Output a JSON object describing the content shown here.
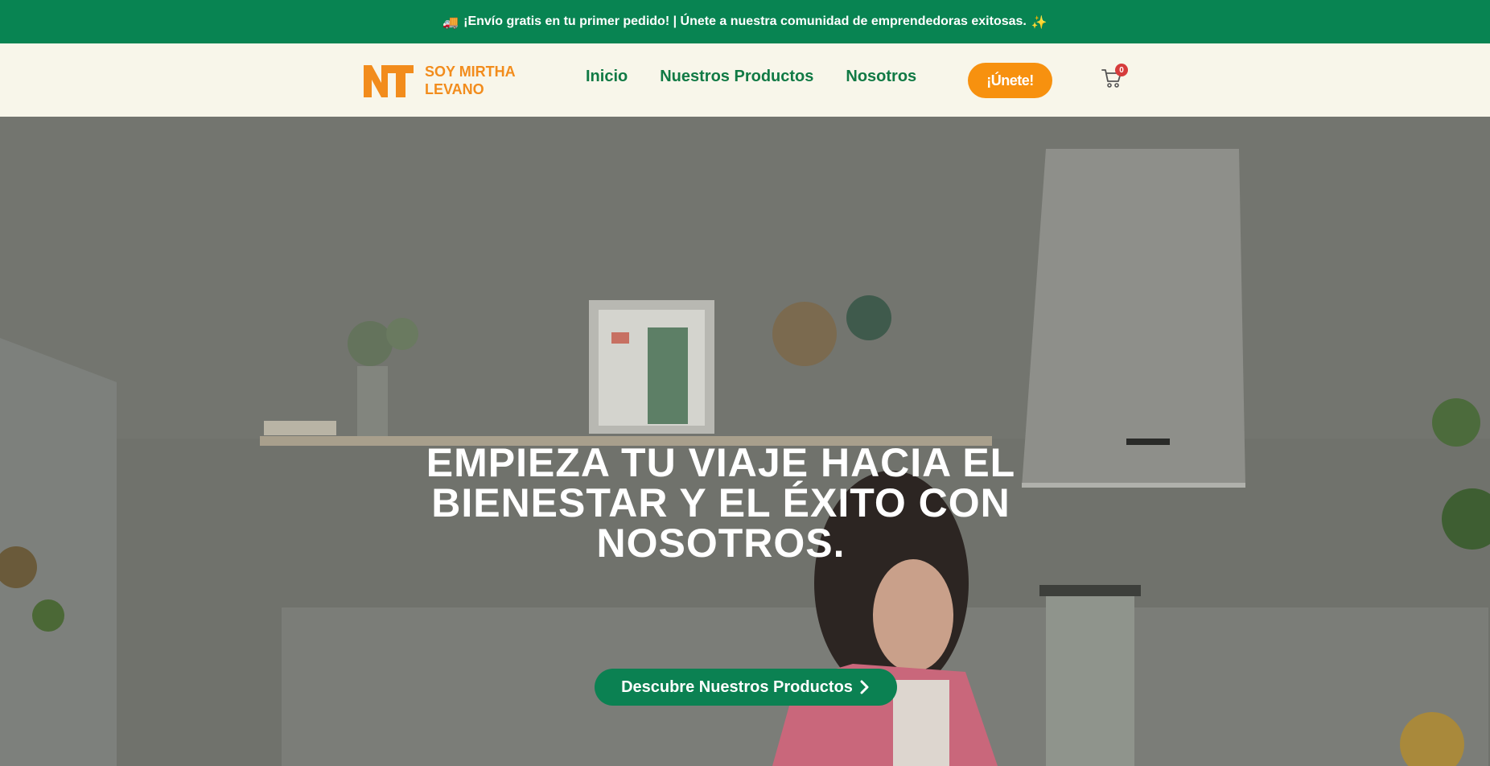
{
  "promo": {
    "truck_emoji": "🚚",
    "text": "¡Envío gratis en tu primer pedido! | Únete a nuestra comunidad de emprendedoras exitosas.",
    "sparkle_emoji": "✨"
  },
  "brand": {
    "name_line1": "SOY MIRTHA",
    "name_line2": "LEVANO",
    "color": "#f28c1c"
  },
  "nav": {
    "items": [
      {
        "label": "Inicio"
      },
      {
        "label": "Nuestros Productos"
      },
      {
        "label": "Nosotros"
      }
    ]
  },
  "header": {
    "join_label": "¡Únete!",
    "cart_count": "0"
  },
  "hero": {
    "title": "EMPIEZA TU VIAJE HACIA EL BIENESTAR Y EL ÉXITO CON NOSOTROS.",
    "cta_label": "Descubre Nuestros Productos",
    "cta_icon": "chevron-right-icon"
  },
  "colors": {
    "promo_bg": "#088452",
    "header_bg": "#f8f6ea",
    "nav_text": "#117a45",
    "join_bg": "#f7910f",
    "cta_bg": "#0b8152",
    "badge": "#d63c3c"
  }
}
